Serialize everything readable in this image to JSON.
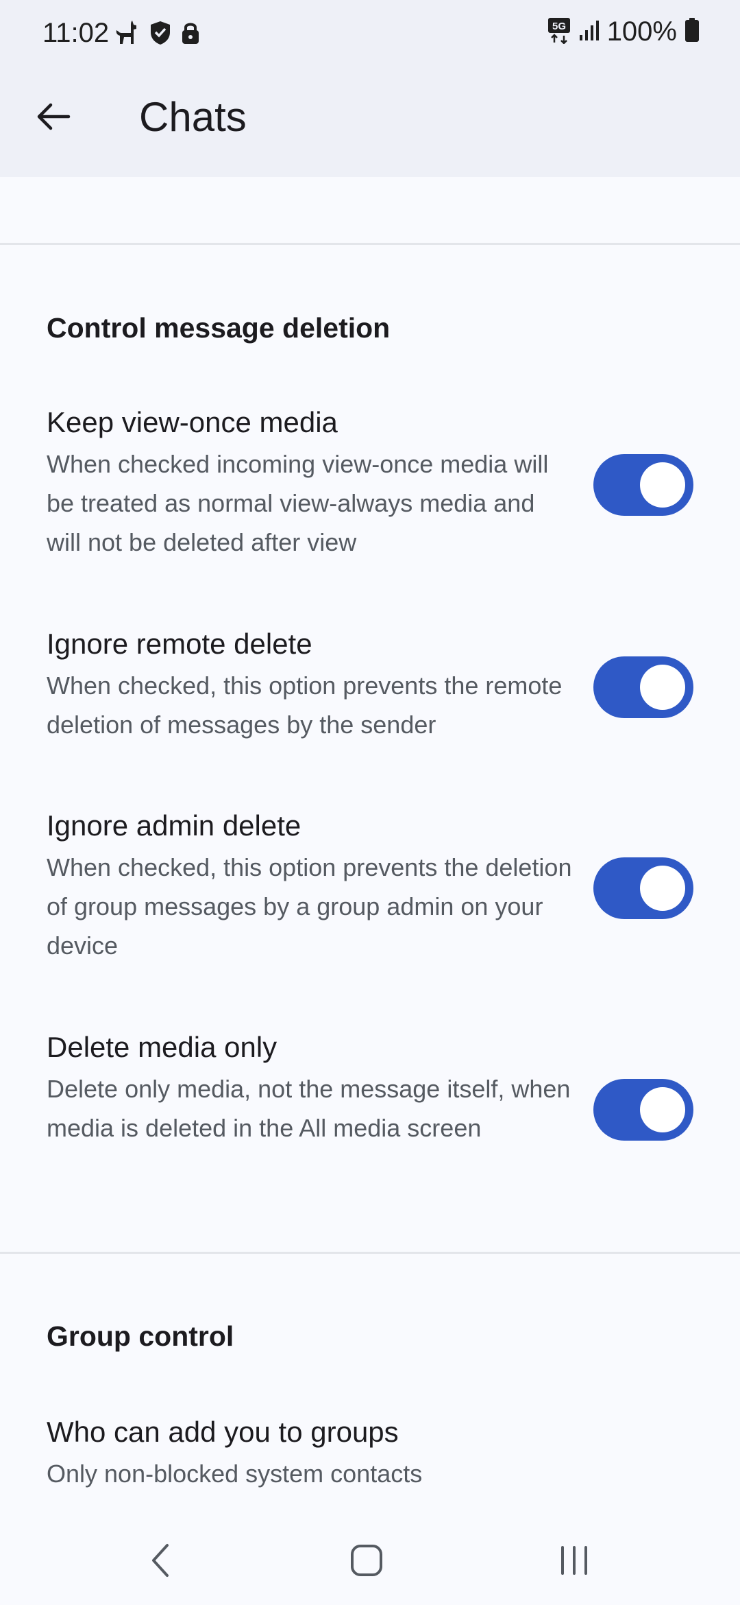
{
  "status_bar": {
    "time": "11:02",
    "battery": "100%",
    "icons_left": [
      "llama-icon",
      "shield-icon",
      "lock-icon"
    ],
    "icons_right": [
      "5g-icon",
      "signal-icon",
      "battery-icon"
    ]
  },
  "app_bar": {
    "title": "Chats"
  },
  "sections": {
    "deletion": {
      "header": "Control message deletion",
      "items": [
        {
          "title": "Keep view-once media",
          "description": "When checked incoming view-once media will be treated as normal view-always media and will not be deleted after view",
          "enabled": true
        },
        {
          "title": "Ignore remote delete",
          "description": "When checked, this option prevents the remote deletion of messages by the sender",
          "enabled": true
        },
        {
          "title": "Ignore admin delete",
          "description": "When checked, this option prevents the deletion of group messages by a group admin on your device",
          "enabled": true
        },
        {
          "title": "Delete media only",
          "description": "Delete only media, not the message itself, when media is deleted in the All media screen",
          "enabled": true
        }
      ]
    },
    "group": {
      "header": "Group control",
      "items": [
        {
          "title": "Who can add you to groups",
          "description": "Only non-blocked system contacts"
        }
      ]
    }
  },
  "colors": {
    "accent": "#2f59c6",
    "topbar_bg": "#eef0f7",
    "page_bg": "#f9fafe"
  }
}
